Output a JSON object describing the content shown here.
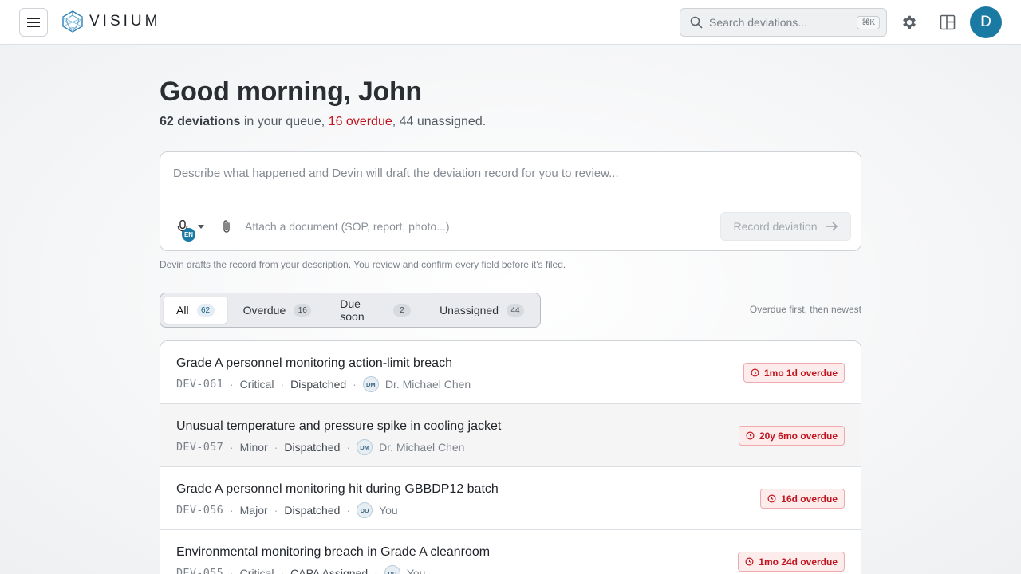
{
  "header": {
    "brand": "VISIUM",
    "search_placeholder": "Search deviations...",
    "search_shortcut": "⌘K",
    "avatar_initial": "D"
  },
  "greeting": "Good morning, John",
  "summary": {
    "count": "62 deviations",
    "text1": " in your queue, ",
    "overdue": "16 overdue",
    "text2": ", 44 unassigned."
  },
  "composer": {
    "placeholder": "Describe what happened and Devin will draft the deviation record for you to review...",
    "language": "EN",
    "attach_label": "Attach a document (SOP, report, photo...)",
    "submit_label": "Record deviation",
    "hint": "Devin drafts the record from your description. You review and confirm every field before it's filed."
  },
  "tabs": [
    {
      "label": "All",
      "count": "62",
      "active": true
    },
    {
      "label": "Overdue",
      "count": "16",
      "active": false
    },
    {
      "label": "Due soon",
      "count": "2",
      "active": false
    },
    {
      "label": "Unassigned",
      "count": "44",
      "active": false
    }
  ],
  "sort_note": "Overdue first, then newest",
  "deviations": [
    {
      "title": "Grade A personnel monitoring action-limit breach",
      "id": "DEV-061",
      "severity": "Critical",
      "status": "Dispatched",
      "initials": "DM",
      "assignee": "Dr. Michael Chen",
      "overdue": "1mo 1d overdue"
    },
    {
      "title": "Unusual temperature and pressure spike in cooling jacket",
      "id": "DEV-057",
      "severity": "Minor",
      "status": "Dispatched",
      "initials": "DM",
      "assignee": "Dr. Michael Chen",
      "overdue": "20y 6mo overdue"
    },
    {
      "title": "Grade A personnel monitoring hit during GBBDP12 batch",
      "id": "DEV-056",
      "severity": "Major",
      "status": "Dispatched",
      "initials": "DU",
      "assignee": "You",
      "overdue": "16d overdue"
    },
    {
      "title": "Environmental monitoring breach in Grade A cleanroom",
      "id": "DEV-055",
      "severity": "Critical",
      "status": "CAPA Assigned",
      "initials": "DU",
      "assignee": "You",
      "overdue": "1mo 24d overdue"
    }
  ],
  "colors": {
    "accent": "#1b7aa3",
    "overdue_red": "#c0151f"
  }
}
